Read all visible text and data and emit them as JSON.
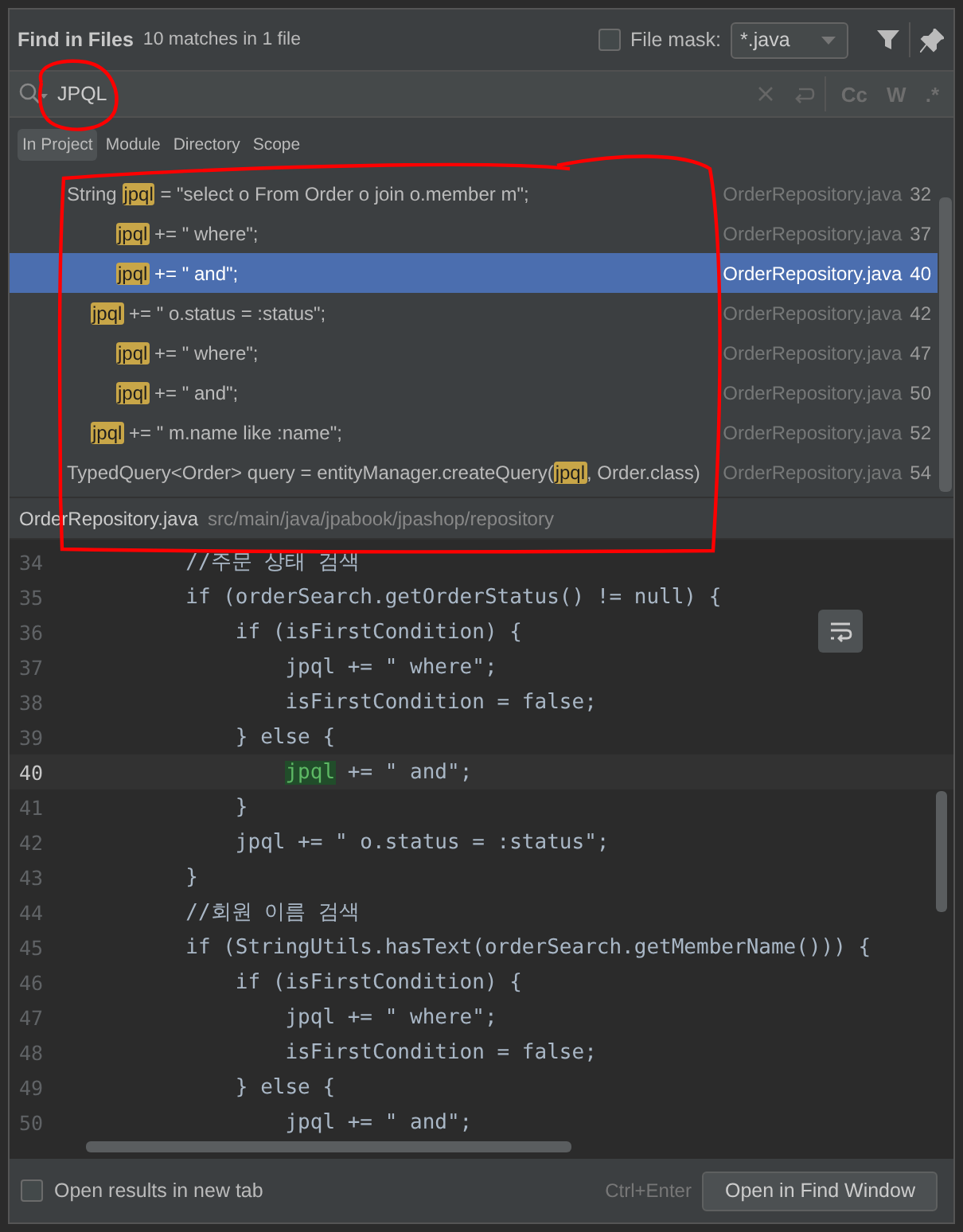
{
  "dialog": {
    "title": "Find in Files",
    "summary": "10 matches in 1 file",
    "file_mask": {
      "label": "File mask:",
      "checked": false,
      "value": "*.java"
    }
  },
  "search": {
    "value": "JPQL",
    "options": [
      {
        "label": "Cc"
      },
      {
        "label": "W"
      },
      {
        "label": ".*"
      }
    ]
  },
  "scopes": [
    {
      "label": "In Project",
      "selected": true
    },
    {
      "label": "Module",
      "selected": false
    },
    {
      "label": "Directory",
      "selected": false
    },
    {
      "label": "Scope",
      "selected": false
    }
  ],
  "results": [
    {
      "kind": "outer",
      "text": "String **jpql** = \"select o From Order o join o.member m\";",
      "file": "OrderRepository.java",
      "line": "32",
      "selected": false
    },
    {
      "kind": "deep",
      "text": "**jpql** += \" where\";",
      "file": "OrderRepository.java",
      "line": "37",
      "selected": false
    },
    {
      "kind": "deep",
      "text": "**jpql** += \" and\";",
      "file": "OrderRepository.java",
      "line": "40",
      "selected": true
    },
    {
      "kind": "middle",
      "text": "**jpql** += \" o.status = :status\";",
      "file": "OrderRepository.java",
      "line": "42",
      "selected": false
    },
    {
      "kind": "deep",
      "text": "**jpql** += \" where\";",
      "file": "OrderRepository.java",
      "line": "47",
      "selected": false
    },
    {
      "kind": "deep",
      "text": "**jpql** += \" and\";",
      "file": "OrderRepository.java",
      "line": "50",
      "selected": false
    },
    {
      "kind": "middle",
      "text": "**jpql** += \" m.name like :name\";",
      "file": "OrderRepository.java",
      "line": "52",
      "selected": false
    },
    {
      "kind": "outer",
      "text": "TypedQuery<Order> query = entityManager.createQuery(**jpql**, Order.class)",
      "file": "OrderRepository.java",
      "line": "54",
      "selected": false
    }
  ],
  "preview": {
    "file": "OrderRepository.java",
    "path": "src/main/java/jpabook/jpashop/repository",
    "lines": [
      {
        "number": "34",
        "current": false,
        "text": "        //주문 상태 검색"
      },
      {
        "number": "35",
        "current": false,
        "text": "        if (orderSearch.getOrderStatus() != null) {"
      },
      {
        "number": "36",
        "current": false,
        "text": "            if (isFirstCondition) {"
      },
      {
        "number": "37",
        "current": false,
        "text": "                jpql += \" where\";"
      },
      {
        "number": "38",
        "current": false,
        "text": "                isFirstCondition = false;"
      },
      {
        "number": "39",
        "current": false,
        "text": "            } else {"
      },
      {
        "number": "40",
        "current": true,
        "text": "                **jpql** += \" and\";"
      },
      {
        "number": "41",
        "current": false,
        "text": "            }"
      },
      {
        "number": "42",
        "current": false,
        "text": "            jpql += \" o.status = :status\";"
      },
      {
        "number": "43",
        "current": false,
        "text": "        }"
      },
      {
        "number": "44",
        "current": false,
        "text": "        //회원 이름 검색"
      },
      {
        "number": "45",
        "current": false,
        "text": "        if (StringUtils.hasText(orderSearch.getMemberName())) {"
      },
      {
        "number": "46",
        "current": false,
        "text": "            if (isFirstCondition) {"
      },
      {
        "number": "47",
        "current": false,
        "text": "                jpql += \" where\";"
      },
      {
        "number": "48",
        "current": false,
        "text": "                isFirstCondition = false;"
      },
      {
        "number": "49",
        "current": false,
        "text": "            } else {"
      },
      {
        "number": "50",
        "current": false,
        "text": "                jpql += \" and\";"
      }
    ]
  },
  "footer": {
    "new_tab": {
      "label": "Open results in new tab",
      "checked": false
    },
    "shortcut": "Ctrl+Enter",
    "button": "Open in Find Window"
  }
}
